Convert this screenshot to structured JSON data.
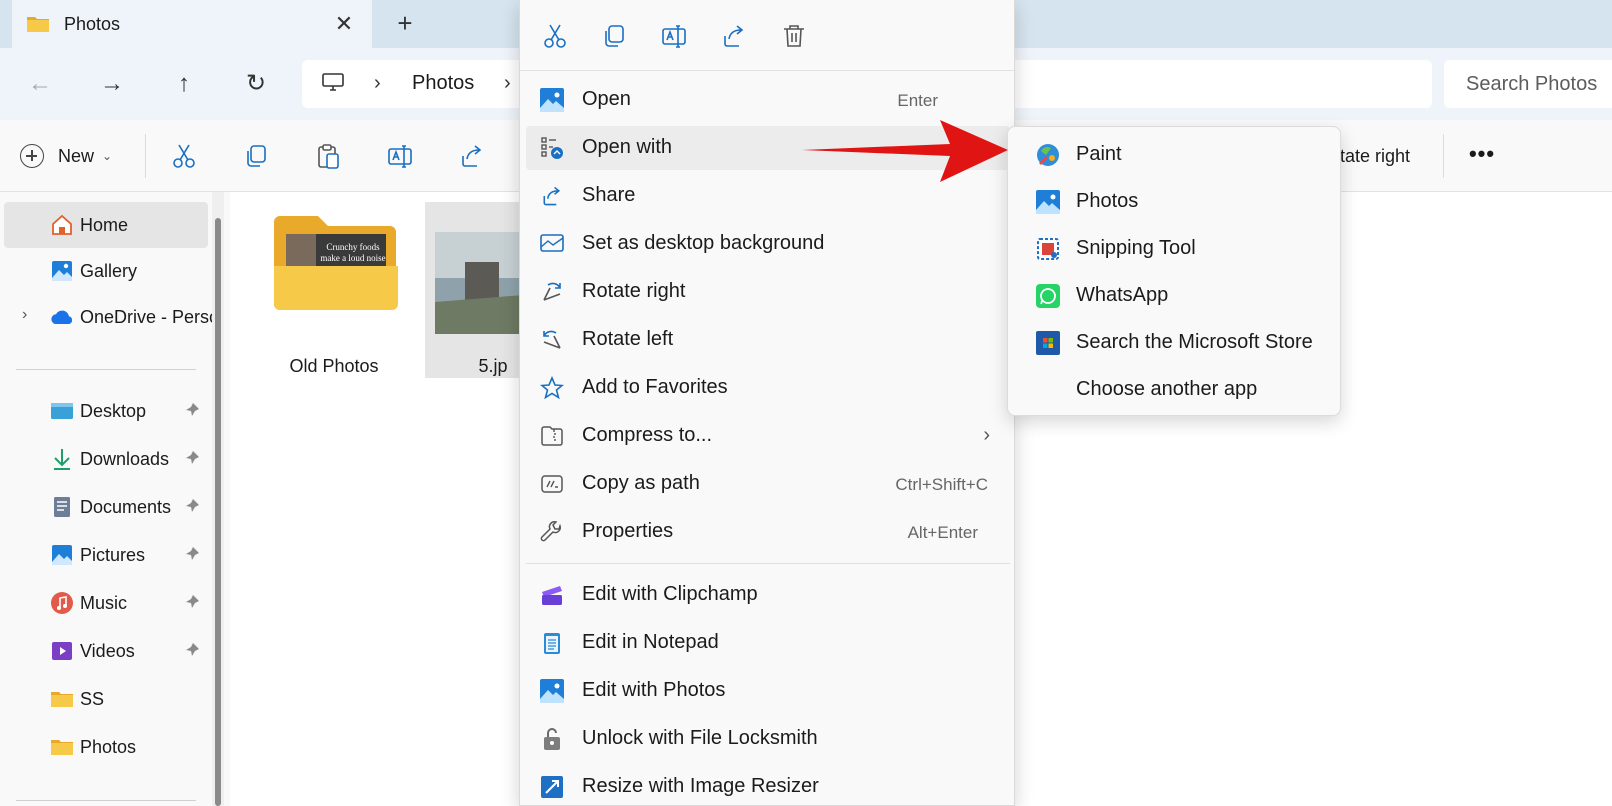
{
  "colors": {
    "accent": "#0067c0",
    "arrow": "#e11414",
    "folder": "#f7c948"
  },
  "tab": {
    "title": "Photos",
    "close_glyph": "✕",
    "add_glyph": "+"
  },
  "nav": {
    "back": "←",
    "forward": "→",
    "up": "↑",
    "refresh": "↻"
  },
  "address": {
    "sep": "›",
    "crumbs": [
      "Photos"
    ]
  },
  "search": {
    "placeholder": "Search Photos"
  },
  "command_bar": {
    "new_label": "New",
    "new_chevron": "⌄",
    "rotate_right_label": "otate right",
    "more_label": "•••",
    "icons": [
      "cut-icon",
      "copy-icon",
      "paste-icon",
      "rename-icon",
      "share-icon"
    ]
  },
  "sidebar": {
    "expand_glyph": "›",
    "items": [
      {
        "label": "Home",
        "icon": "home-icon",
        "selected": true
      },
      {
        "label": "Gallery",
        "icon": "gallery-icon"
      },
      {
        "label": "OneDrive - Perso",
        "icon": "onedrive-icon",
        "expandable": true
      },
      {
        "label": "Desktop",
        "icon": "desktop-icon",
        "pinned": true
      },
      {
        "label": "Downloads",
        "icon": "downloads-icon",
        "pinned": true
      },
      {
        "label": "Documents",
        "icon": "documents-icon",
        "pinned": true
      },
      {
        "label": "Pictures",
        "icon": "pictures-icon",
        "pinned": true
      },
      {
        "label": "Music",
        "icon": "music-icon",
        "pinned": true
      },
      {
        "label": "Videos",
        "icon": "videos-icon",
        "pinned": true
      },
      {
        "label": "SS",
        "icon": "folder-icon"
      },
      {
        "label": "Photos",
        "icon": "folder-icon"
      }
    ]
  },
  "files": [
    {
      "name": "Old Photos",
      "kind": "folder",
      "folder_text": "Crunchy foods make a loud noise"
    },
    {
      "name": "5.jp",
      "kind": "image",
      "selected": true
    }
  ],
  "context_menu": {
    "quick_actions": [
      "cut-icon",
      "copy-icon",
      "rename-icon",
      "share-icon",
      "delete-icon"
    ],
    "items": [
      {
        "label": "Open",
        "key": "Enter",
        "icon": "photos-app-icon"
      },
      {
        "label": "Open with",
        "icon": "open-with-icon",
        "hover": true
      },
      {
        "label": "Share",
        "icon": "share-icon"
      },
      {
        "label": "Set as desktop background",
        "icon": "desktop-background-icon"
      },
      {
        "label": "Rotate right",
        "icon": "rotate-right-icon"
      },
      {
        "label": "Rotate left",
        "icon": "rotate-left-icon"
      },
      {
        "label": "Add to Favorites",
        "icon": "star-icon"
      },
      {
        "label": "Compress to...",
        "icon": "zip-icon",
        "submenu": "›"
      },
      {
        "label": "Copy as path",
        "key": "Ctrl+Shift+C",
        "icon": "copy-path-icon"
      },
      {
        "label": "Properties",
        "key": "Alt+Enter",
        "icon": "wrench-icon"
      },
      {
        "label": "Edit with Clipchamp",
        "icon": "clipchamp-icon"
      },
      {
        "label": "Edit in Notepad",
        "icon": "notepad-icon"
      },
      {
        "label": "Edit with Photos",
        "icon": "photos-app-icon"
      },
      {
        "label": "Unlock with File Locksmith",
        "icon": "lock-icon"
      },
      {
        "label": "Resize with Image Resizer",
        "icon": "resize-icon"
      }
    ]
  },
  "open_with": {
    "items": [
      {
        "label": "Paint",
        "icon": "paint-icon"
      },
      {
        "label": "Photos",
        "icon": "photos-app-icon"
      },
      {
        "label": "Snipping Tool",
        "icon": "snipping-tool-icon"
      },
      {
        "label": "WhatsApp",
        "icon": "whatsapp-icon"
      },
      {
        "label": "Search the Microsoft Store",
        "icon": "store-icon"
      },
      {
        "label": "Choose another app",
        "icon": ""
      }
    ]
  }
}
